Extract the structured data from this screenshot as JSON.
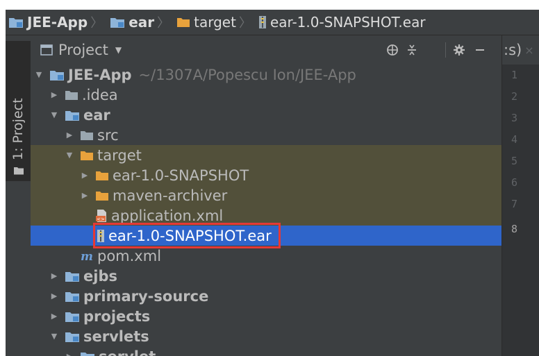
{
  "breadcrumb": {
    "items": [
      {
        "label": "JEE-App",
        "icon": "module-folder-icon",
        "bold": true
      },
      {
        "label": "ear",
        "icon": "module-folder-icon",
        "bold": true
      },
      {
        "label": "target",
        "icon": "excluded-folder-icon",
        "bold": false
      },
      {
        "label": "ear-1.0-SNAPSHOT.ear",
        "icon": "archive-icon",
        "bold": false
      }
    ]
  },
  "tool_stripe": {
    "label": "1: Project"
  },
  "project_panel": {
    "view_label": "Project",
    "tools": [
      "locate-icon",
      "collapse-all-icon",
      "gear-icon",
      "hide-icon"
    ]
  },
  "tree": {
    "rows": [
      {
        "label": "JEE-App",
        "path": "~/1307A/Popescu Ion/JEE-App",
        "arrow": "expanded",
        "icon": "module-folder-icon",
        "bold": true
      },
      {
        "label": ".idea",
        "arrow": "collapsed",
        "icon": "folder-icon",
        "bold": false
      },
      {
        "label": "ear",
        "arrow": "expanded",
        "icon": "module-folder-icon",
        "bold": true
      },
      {
        "label": "src",
        "arrow": "collapsed",
        "icon": "folder-icon",
        "bold": false
      },
      {
        "label": "target",
        "arrow": "expanded",
        "icon": "excluded-folder-icon",
        "bold": false
      },
      {
        "label": "ear-1.0-SNAPSHOT",
        "arrow": "collapsed",
        "icon": "excluded-folder-icon",
        "bold": false
      },
      {
        "label": "maven-archiver",
        "arrow": "collapsed",
        "icon": "excluded-folder-icon",
        "bold": false
      },
      {
        "label": "application.xml",
        "arrow": "none",
        "icon": "xml-file-icon",
        "bold": false
      },
      {
        "label": "ear-1.0-SNAPSHOT.ear",
        "arrow": "none",
        "icon": "archive-icon",
        "bold": false
      },
      {
        "label": "pom.xml",
        "arrow": "none",
        "icon": "maven-icon",
        "bold": false
      },
      {
        "label": "ejbs",
        "arrow": "collapsed",
        "icon": "module-folder-icon",
        "bold": true
      },
      {
        "label": "primary-source",
        "arrow": "collapsed",
        "icon": "module-folder-icon",
        "bold": true
      },
      {
        "label": "projects",
        "arrow": "collapsed",
        "icon": "module-folder-icon",
        "bold": true
      },
      {
        "label": "servlets",
        "arrow": "expanded",
        "icon": "module-folder-icon",
        "bold": true
      },
      {
        "label": "servlet",
        "arrow": "collapsed",
        "icon": "module-folder-icon",
        "bold": true
      }
    ]
  },
  "editor": {
    "tab_label": ":s)",
    "line_numbers": [
      "1",
      "2",
      "3",
      "4",
      "5",
      "6",
      "7",
      "8"
    ],
    "current_line": "8"
  },
  "colors": {
    "panel_bg": "#3c3f41",
    "selection": "#2f65ca",
    "excluded_highlight": "#52503a",
    "excluded_folder": "#e8a23c",
    "module_folder": "#8eb4d9",
    "annotation_box": "#e53935"
  }
}
